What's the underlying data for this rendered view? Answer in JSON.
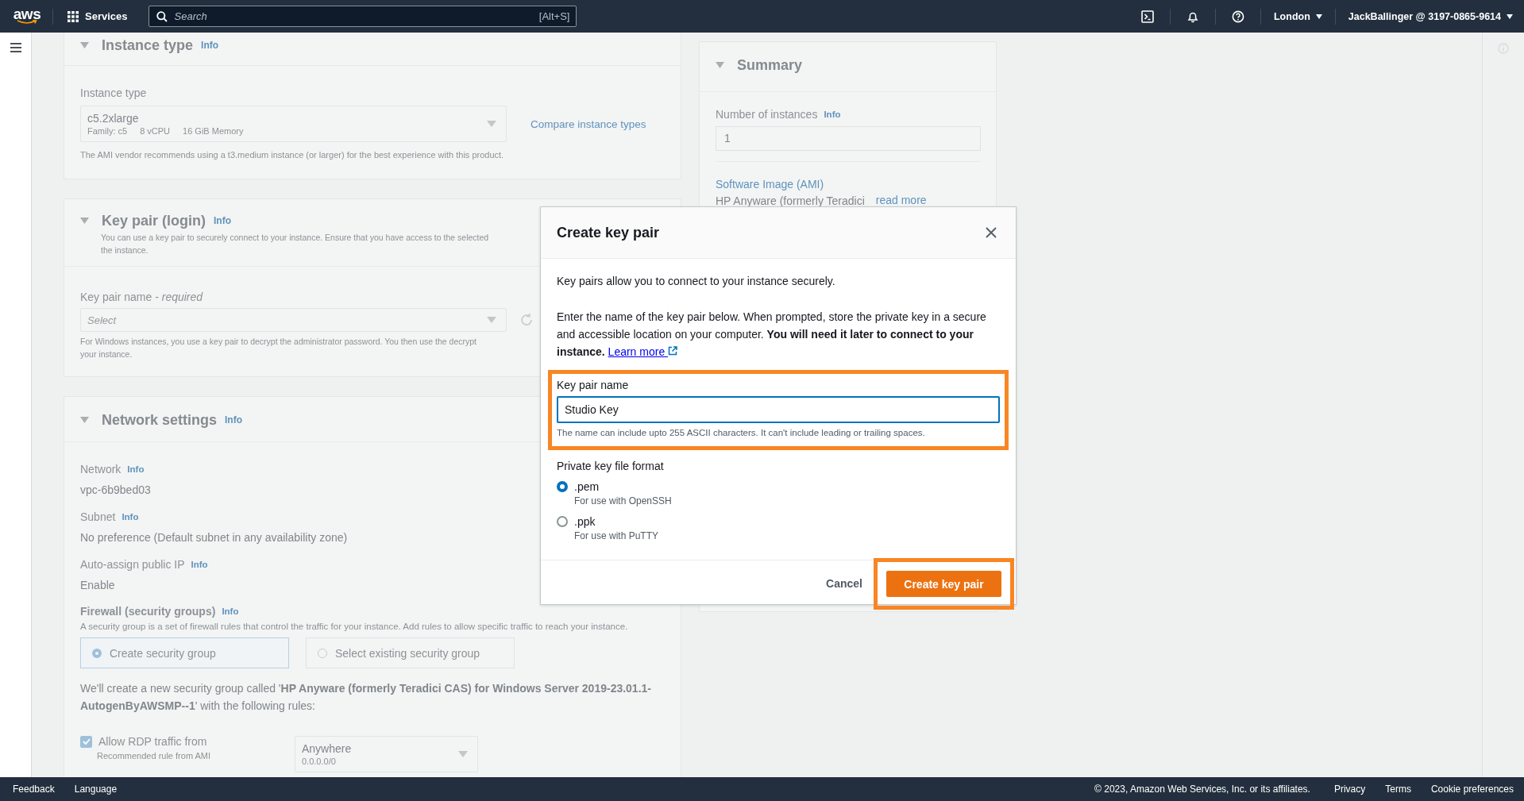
{
  "top_nav": {
    "logo": "aws",
    "services": "Services",
    "search": {
      "placeholder": "Search",
      "shortcut": "[Alt+S]"
    },
    "region": "London",
    "account": "JackBallinger @ 3197-0865-9614"
  },
  "instance_type": {
    "title": "Instance type",
    "info": "Info",
    "expanded": true,
    "field_label": "Instance type",
    "value": "c5.2xlarge",
    "meta": [
      "Family: c5",
      "8 vCPU",
      "16 GiB Memory"
    ],
    "compare_link": "Compare instance types",
    "hint": "The AMI vendor recommends using a t3.medium instance (or larger) for the best experience with this product."
  },
  "key_pair": {
    "title": "Key pair (login)",
    "info": "Info",
    "expanded": true,
    "description_lines": [
      "You can use a key pair to securely connect to your instance. Ensure that you have access to the selected",
      "the instance."
    ],
    "field_label": "Key pair name - *required*",
    "placeholder": "Select",
    "hint_lines": [
      "For Windows instances, you use a key pair to decrypt the administrator password. You then use the decrypt",
      "your instance."
    ]
  },
  "network": {
    "title": "Network settings",
    "info": "Info",
    "expanded": true,
    "fields": [
      {
        "label": "Network",
        "info": "Info",
        "value": "vpc-6b9bed03"
      },
      {
        "label": "Subnet",
        "info": "Info",
        "value": "No preference (Default subnet in any availability zone)"
      },
      {
        "label": "Auto-assign public IP",
        "info": "Info",
        "value": "Enable"
      }
    ],
    "firewall": {
      "label": "Firewall (security groups)",
      "info": "Info",
      "description": "A security group is a set of firewall rules that control the traffic for your instance. Add rules to allow specific traffic to reach your instance.",
      "options": [
        {
          "label": "Create security group",
          "selected": true
        },
        {
          "label": "Select existing security group",
          "selected": false
        }
      ],
      "note": "We'll create a new security group called '**HP Anyware (formerly Teradici CAS) for Windows Server 2019-23.01.1-AutogenByAWSMP--1**' with the following rules:",
      "rules": [
        {
          "label": "Allow RDP traffic from",
          "sublabel": "Recommended rule from AMI",
          "checked": true,
          "source": "Anywhere",
          "source_detail": "0.0.0.0/0"
        }
      ]
    }
  },
  "summary": {
    "title": "Summary",
    "expanded": true,
    "instances_label": "Number of instances",
    "info": "Info",
    "instances_value": "1",
    "ami_link": "Software Image (AMI)",
    "ami_name": "HP Anyware (formerly Teradici",
    "read_more": "read more"
  },
  "modal": {
    "title": "Create key pair",
    "intro": "Key pairs allow you to connect to your instance securely.",
    "body": "Enter the name of the key pair below. When prompted, store the private key in a secure and accessible location on your computer. **You will need it later to connect to your instance.**",
    "learn_more": "Learn more",
    "name_field": {
      "label": "Key pair name",
      "value": "Studio Key",
      "hint": "The name can include upto 255 ASCII characters. It can't include leading or trailing spaces.",
      "highlighted": true
    },
    "format": {
      "label": "Private key file format",
      "options": [
        {
          "label": ".pem",
          "description": "For use with OpenSSH",
          "selected": true
        },
        {
          "label": ".ppk",
          "description": "For use with PuTTY",
          "selected": false
        }
      ]
    },
    "buttons": [
      {
        "label": "Cancel",
        "kind": "link",
        "highlighted": false
      },
      {
        "label": "Create key pair",
        "kind": "primary",
        "highlighted": true
      }
    ]
  },
  "footer": {
    "links_left": [
      "Feedback",
      "Language"
    ],
    "copyright": "© 2023, Amazon Web Services, Inc. or its affiliates.",
    "links_right": [
      "Privacy",
      "Terms",
      "Cookie preferences"
    ]
  }
}
